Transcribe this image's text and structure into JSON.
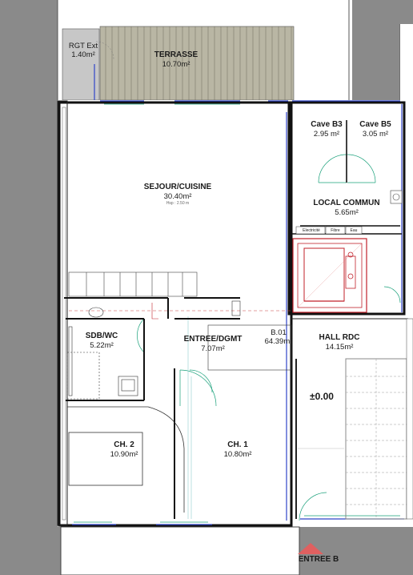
{
  "rooms": {
    "rgt_ext": {
      "name": "RGT Ext",
      "area": "1.40m²"
    },
    "terrasse": {
      "name": "TERRASSE",
      "area": "10.70m²"
    },
    "sejour": {
      "name": "SEJOUR/CUISINE",
      "area": "30.40m²",
      "note": "Hsp : 2.50 m"
    },
    "cave_b3": {
      "name": "Cave B3",
      "area": "2.95 m²"
    },
    "cave_b5": {
      "name": "Cave B5",
      "area": "3.05 m²"
    },
    "local_commun": {
      "name": "LOCAL COMMUN",
      "area": "5.65m²"
    },
    "sdb": {
      "name": "SDB/WC",
      "area": "5.22m²"
    },
    "entree_dgmt": {
      "name": "ENTREE/DGMT",
      "area": "7.07m²"
    },
    "b01": {
      "name": "B.01",
      "area": "64.39m²"
    },
    "hall": {
      "name": "HALL RDC",
      "area": "14.15m²"
    },
    "ch2": {
      "name": "CH. 2",
      "area": "10.90m²"
    },
    "ch1": {
      "name": "CH. 1",
      "area": "10.80m²"
    }
  },
  "meters": [
    "Electricité",
    "Fibre",
    "Eau"
  ],
  "level": "±0.00",
  "entrance": "ENTREE B",
  "colors": {
    "outside": "#8a8a8a",
    "terrasse": "#b9b6a4",
    "wall": "#111111",
    "elevator": "#c0202a",
    "door": "#19a07a",
    "window": "#2f44c8",
    "entrance_arrow": "#e06060"
  }
}
